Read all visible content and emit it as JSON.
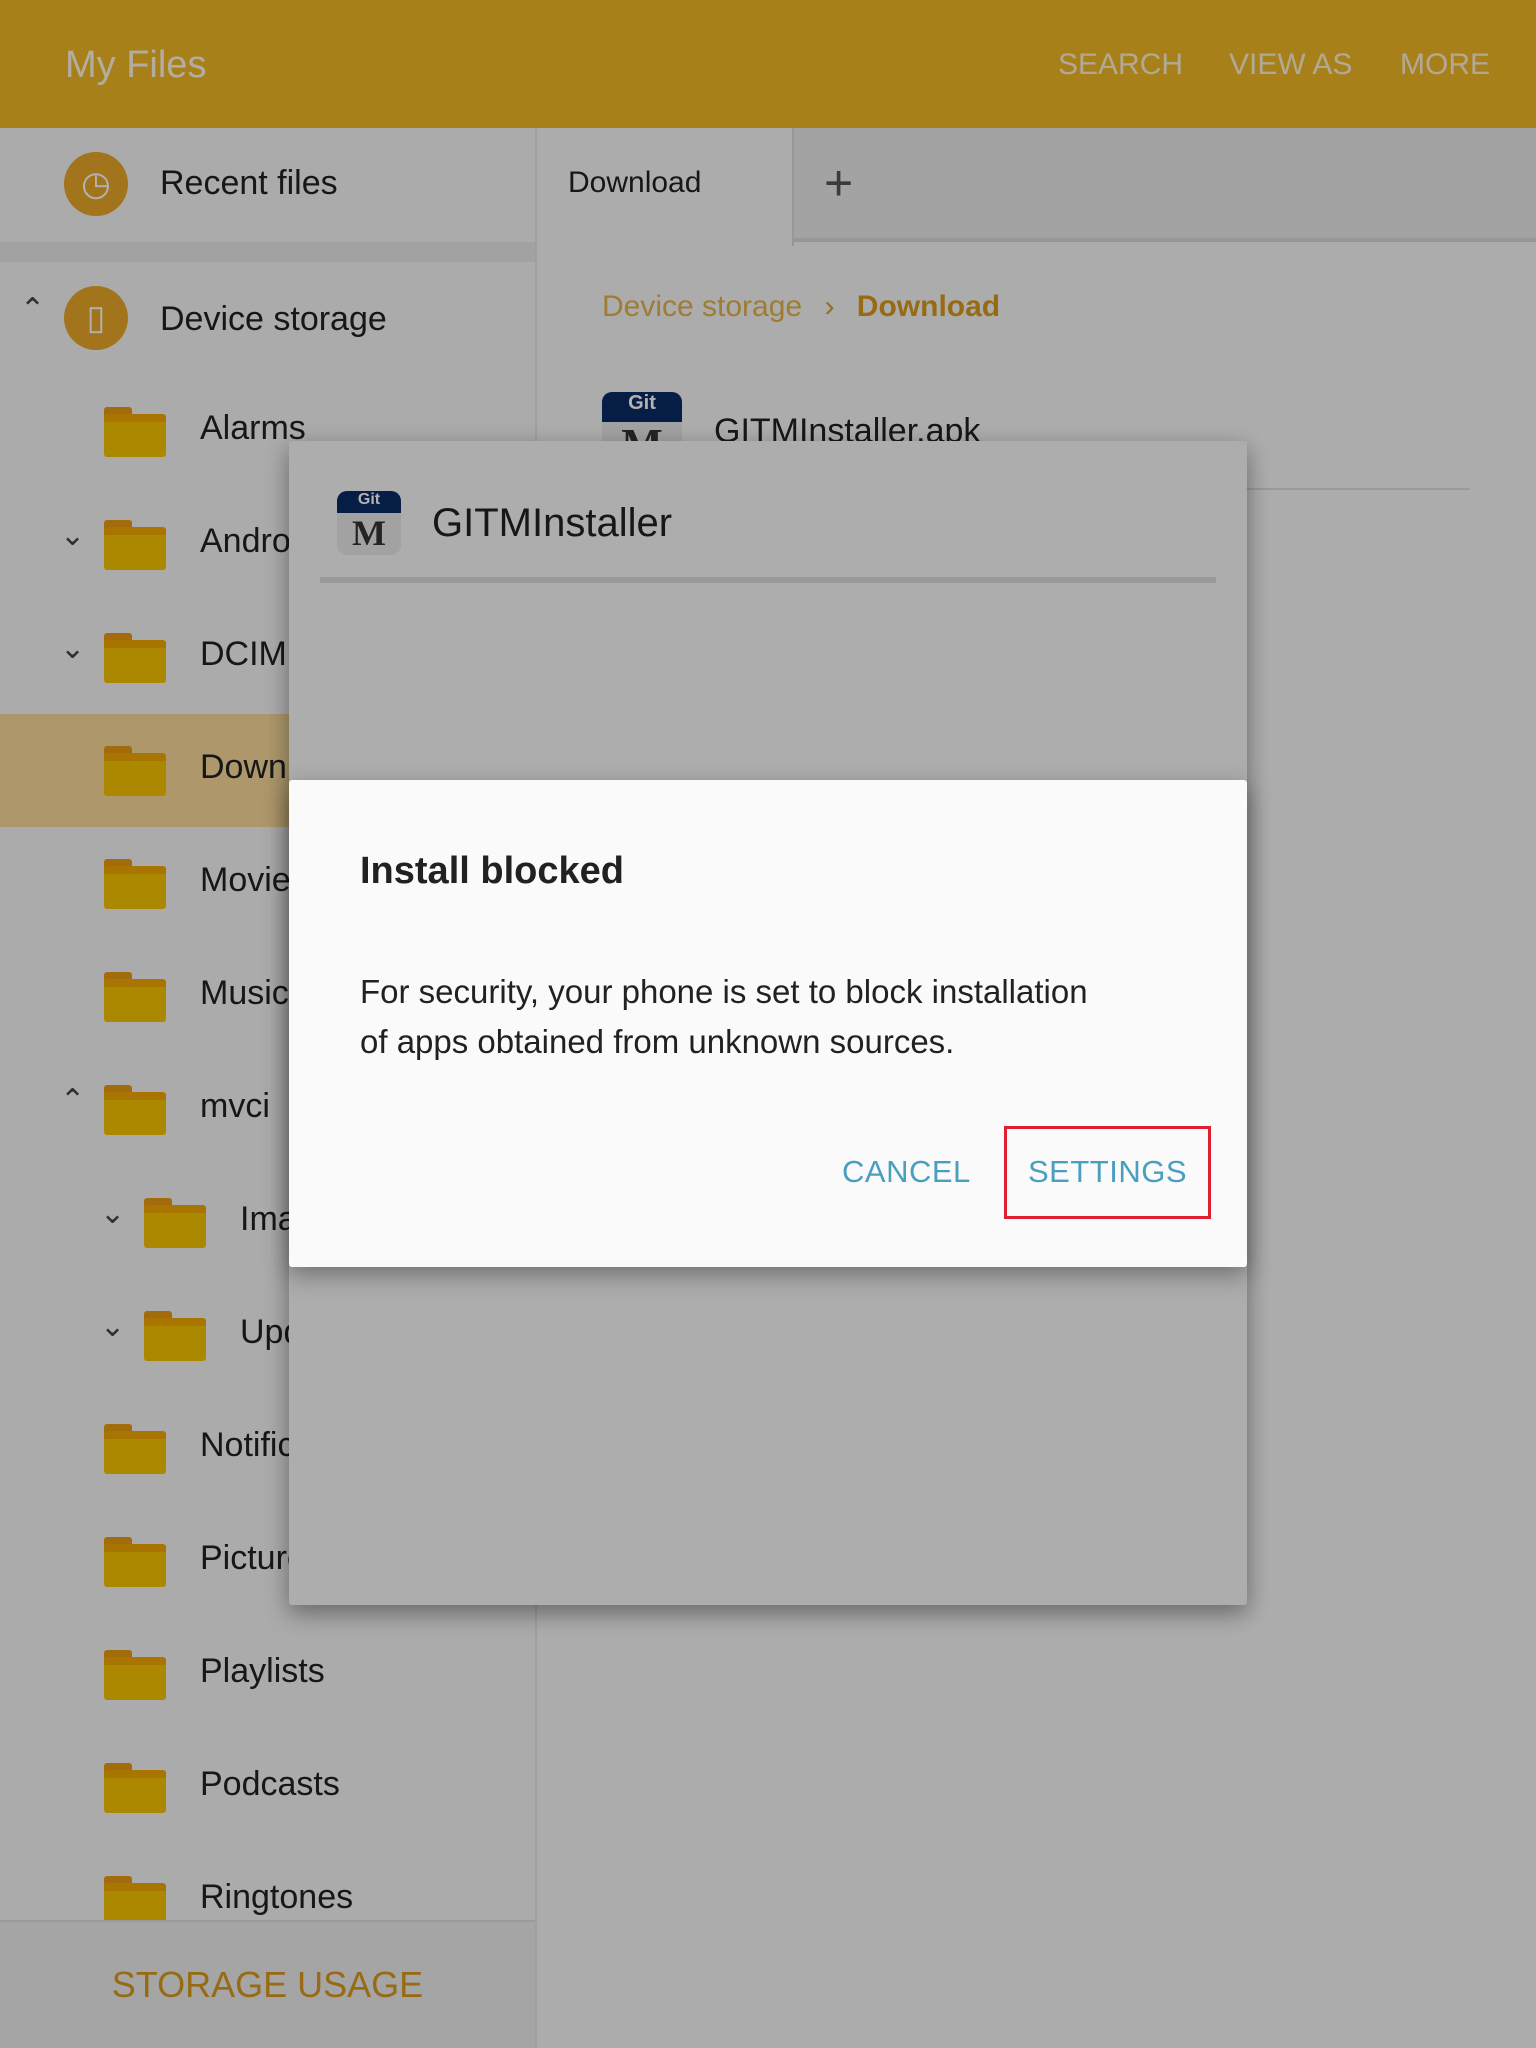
{
  "header": {
    "title": "My Files",
    "actions": [
      "SEARCH",
      "VIEW AS",
      "MORE"
    ]
  },
  "sidebar": {
    "recent": "Recent files",
    "device": "Device storage",
    "folders": [
      {
        "label": "Alarms",
        "chevron": "",
        "indent": 0
      },
      {
        "label": "Android",
        "chevron": "down",
        "indent": 0
      },
      {
        "label": "DCIM",
        "chevron": "down",
        "indent": 0
      },
      {
        "label": "Download",
        "chevron": "",
        "indent": 0,
        "selected": true
      },
      {
        "label": "Movies",
        "chevron": "",
        "indent": 0
      },
      {
        "label": "Music",
        "chevron": "",
        "indent": 0
      },
      {
        "label": "mvci",
        "chevron": "up",
        "indent": 0
      },
      {
        "label": "Images",
        "chevron": "down",
        "indent": 1
      },
      {
        "label": "Update",
        "chevron": "down",
        "indent": 1
      },
      {
        "label": "Notifications",
        "chevron": "",
        "indent": 0
      },
      {
        "label": "Pictures",
        "chevron": "",
        "indent": 0
      },
      {
        "label": "Playlists",
        "chevron": "",
        "indent": 0
      },
      {
        "label": "Podcasts",
        "chevron": "",
        "indent": 0
      },
      {
        "label": "Ringtones",
        "chevron": "",
        "indent": 0
      }
    ],
    "storage_usage": "STORAGE USAGE"
  },
  "main": {
    "tab": "Download",
    "breadcrumb": [
      "Device storage",
      "Download"
    ],
    "file": "GITMInstaller.apk"
  },
  "app_icon": {
    "top": "Git",
    "letter": "M"
  },
  "installer": {
    "title": "GITMInstaller"
  },
  "dialog": {
    "title": "Install blocked",
    "body_lines": [
      "For security, your phone is set to block installation",
      "of apps obtained from unknown sources."
    ],
    "cancel": "CANCEL",
    "settings": "SETTINGS"
  },
  "colors": {
    "accent": "#f0b825",
    "button": "#4a9fbf",
    "highlight": "#e02030"
  }
}
